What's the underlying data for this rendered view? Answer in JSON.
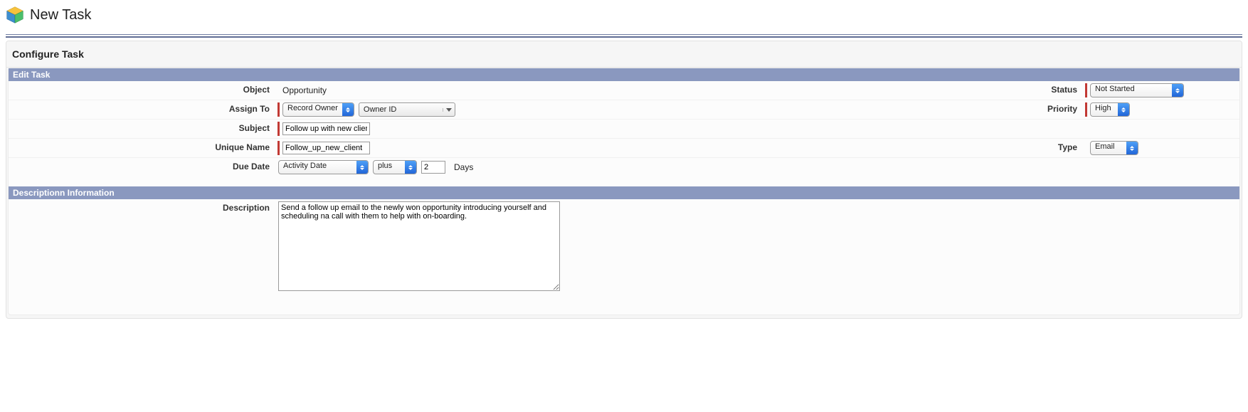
{
  "header": {
    "title": "New Task"
  },
  "configure": {
    "title": "Configure Task"
  },
  "section1": {
    "title": "Edit Task"
  },
  "section2": {
    "title": "Descriptionn Information"
  },
  "labels": {
    "object": "Object",
    "assignTo": "Assign To",
    "subject": "Subject",
    "uniqueName": "Unique Name",
    "dueDate": "Due Date",
    "description": "Description",
    "status": "Status",
    "priority": "Priority",
    "type": "Type",
    "daysUnit": "Days"
  },
  "values": {
    "object": "Opportunity",
    "assignTo_primary": "Record Owner",
    "assignTo_secondary": "Owner ID",
    "subject": "Follow up with new clien",
    "uniqueName": "Follow_up_new_client",
    "dueDate_anchor": "Activity Date",
    "dueDate_operator": "plus",
    "dueDate_offset": "2",
    "status": "Not Started",
    "priority": "High",
    "type": "Email",
    "description": "Send a follow up email to the newly won opportunity introducing yourself and scheduling na call with them to help with on-boarding."
  }
}
